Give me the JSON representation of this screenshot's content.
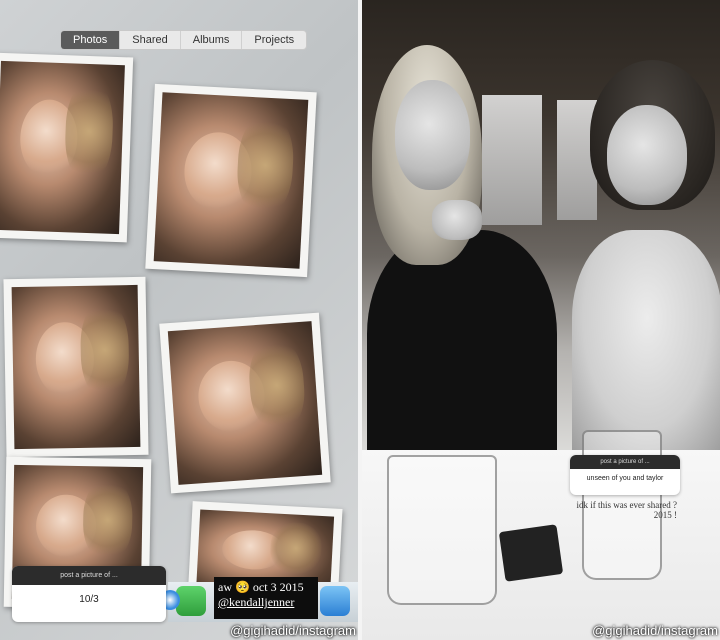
{
  "left": {
    "tabs": [
      {
        "label": "Photos",
        "active": true
      },
      {
        "label": "Shared",
        "active": false
      },
      {
        "label": "Albums",
        "active": false
      },
      {
        "label": "Projects",
        "active": false
      }
    ],
    "story_question": {
      "prompt": "post a picture of ...",
      "answer": "10/3"
    },
    "caption": {
      "line1": "aw 🥺 oct 3 2015",
      "line2": "@kendalljenner"
    },
    "watermark": "@gigihadid/instagram"
  },
  "right": {
    "story_question": {
      "prompt": "post a picture of ...",
      "answer": "unseen of you and taylor"
    },
    "note": {
      "line1": "idk if this was ever shared ?",
      "line2": "2015 !"
    },
    "watermark": "@gigihadid/instagram"
  },
  "icons": [
    "facetime-icon",
    "safari-icon",
    "app-store-icon",
    "itunes-icon"
  ]
}
